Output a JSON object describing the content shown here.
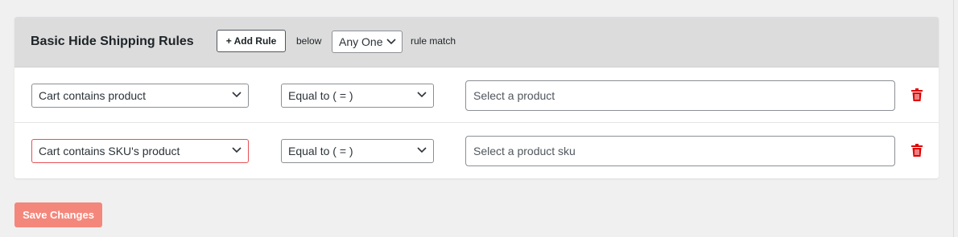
{
  "rules_panel": {
    "title": "Basic Hide Shipping Rules",
    "add_rule_label": "+ Add Rule",
    "below_text": "below",
    "match_select_value": "Any One",
    "match_suffix_text": "rule match"
  },
  "rules": [
    {
      "condition": "Cart contains product",
      "operator": "Equal to ( = )",
      "value_placeholder": "Select a product",
      "delete_icon": "trash-icon"
    },
    {
      "condition": "Cart contains SKU's product",
      "operator": "Equal to ( = )",
      "value_placeholder": "Select a product sku",
      "delete_icon": "trash-icon"
    }
  ],
  "footer": {
    "save_label": "Save Changes"
  },
  "colors": {
    "header_bg": "#dcdcdc",
    "save_button": "#f4877b",
    "delete_icon": "#e00000",
    "error_border": "#e65054"
  }
}
